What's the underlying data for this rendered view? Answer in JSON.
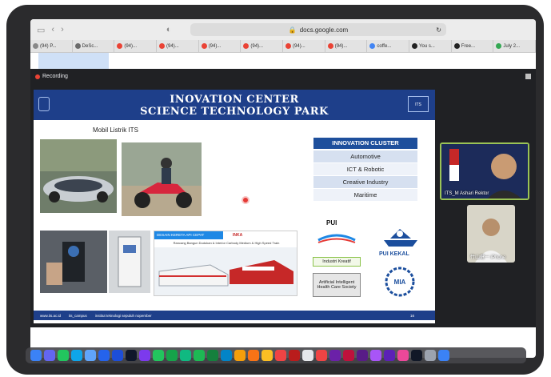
{
  "browser": {
    "url": "docs.google.com",
    "tabs": [
      {
        "label": "(94) P...",
        "color": "#888888"
      },
      {
        "label": "DeSc...",
        "color": "#6b6b6b"
      },
      {
        "label": "(94)...",
        "color": "#ea4335"
      },
      {
        "label": "(94)...",
        "color": "#ea4335"
      },
      {
        "label": "(94)...",
        "color": "#ea4335"
      },
      {
        "label": "(94)...",
        "color": "#ea4335"
      },
      {
        "label": "(94)...",
        "color": "#ea4335"
      },
      {
        "label": "(94)...",
        "color": "#ea4335"
      },
      {
        "label": "coffe...",
        "color": "#4285f4"
      },
      {
        "label": "You s...",
        "color": "#222222"
      },
      {
        "label": "Free...",
        "color": "#222222"
      },
      {
        "label": "July 2...",
        "color": "#34a853"
      }
    ]
  },
  "meeting": {
    "recording_label": "Recording",
    "participants": [
      {
        "name": "ITS_M Ashari Rektor"
      },
      {
        "name": "竹山健一 iPhone"
      }
    ]
  },
  "slide": {
    "title_line1": "INOVATION CENTER",
    "title_line2": "SCIENCE TECHNOLOGY PARK",
    "logo_right_text": "ITS",
    "subtitle": "Mobil Listrik ITS",
    "cluster": {
      "header": "INNOVATION CLUSTER",
      "items": [
        "Automotive",
        "ICT & Robotic",
        "Creative Industry",
        "Maritime"
      ]
    },
    "pui_label": "PUI",
    "pui_kekal_label": "PUI KEKAL",
    "industri_kreatif": "Industri Kreatif",
    "ai_health": "Artificial Intelligent Health Care Society",
    "desain_header": "DESAIN KERETA API CEPAT",
    "desain_sub": "Rancang Bangun Dudukan & Interior Carbody Medium & High Speed Train",
    "inka_label": "INKA",
    "footer_web": "www.its.ac.id",
    "footer_social": "its_campus",
    "footer_name": "institut teknologi sepuluh nopember",
    "page_number": "16"
  },
  "colors": {
    "slide_navy": "#1e3f8a",
    "cluster_blue": "#1e4f9c",
    "cluster_row_a": "#d6e0f0",
    "cluster_row_b": "#eef2f9"
  }
}
